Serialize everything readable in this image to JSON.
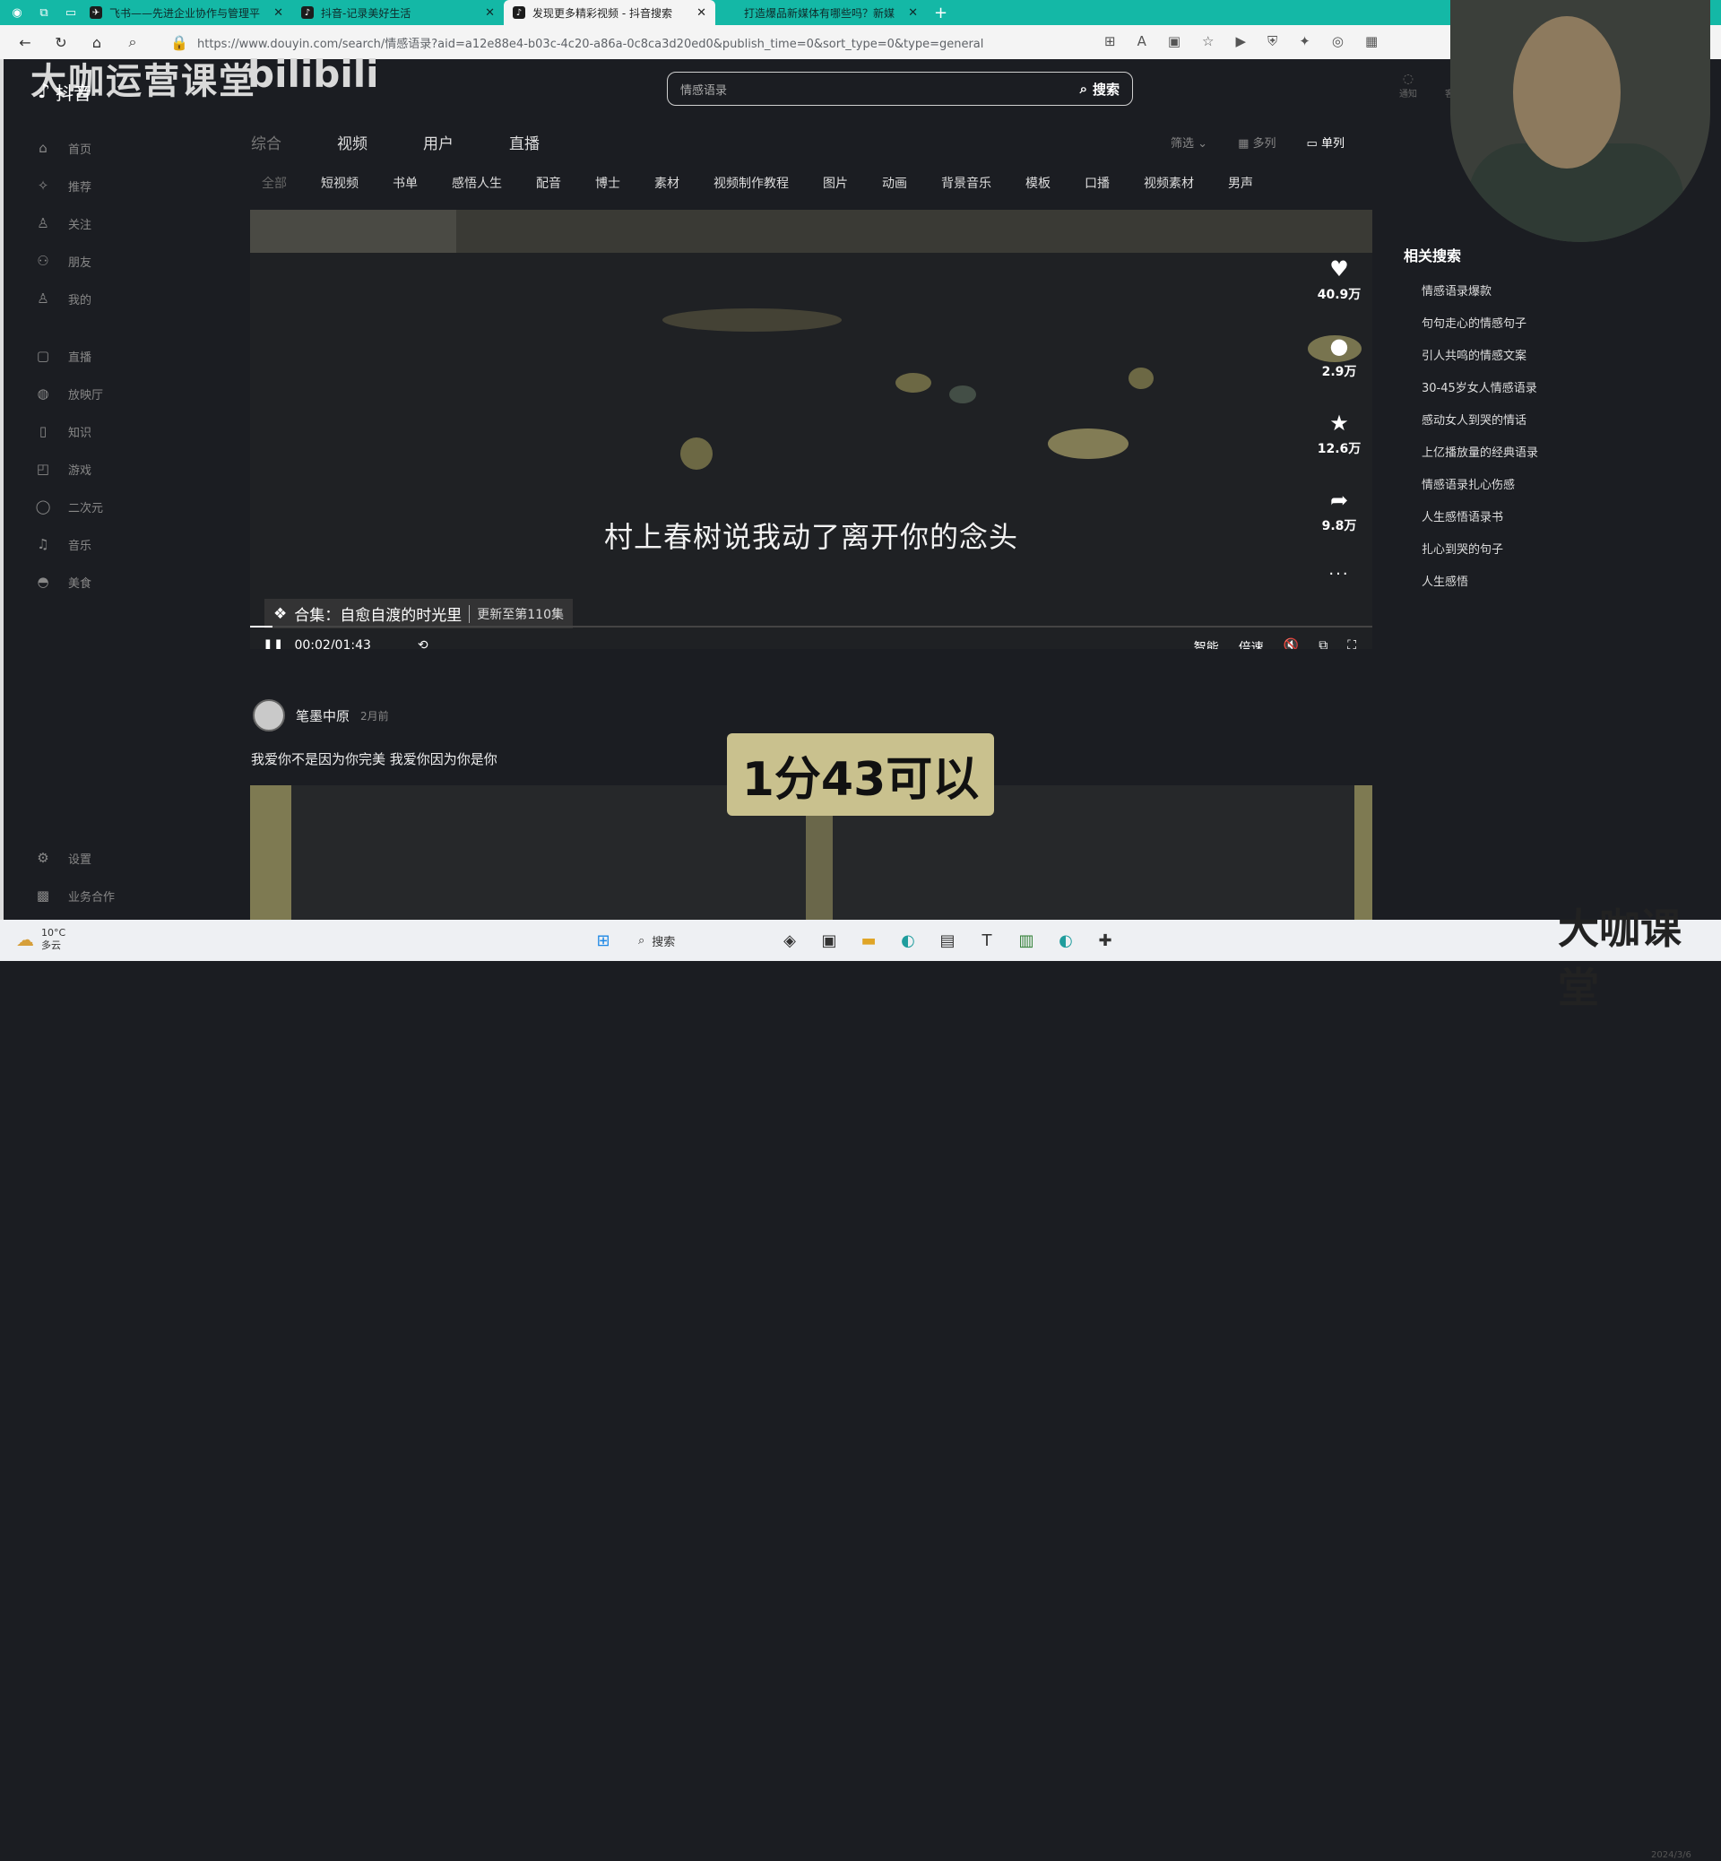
{
  "browser": {
    "tabs": [
      {
        "title": "飞书——先进企业协作与管理平",
        "icon": "feishu-icon"
      },
      {
        "title": "抖音-记录美好生活",
        "icon": "douyin-icon"
      },
      {
        "title": "发现更多精彩视频 - 抖音搜索",
        "icon": "douyin-icon",
        "active": true
      },
      {
        "title": "打造爆品新媒体有哪些吗？新媒",
        "icon": "page-icon"
      }
    ],
    "url": "https://www.douyin.com/search/情感语录?aid=a12e88e4-b03c-4c20-a86a-0c8ca3d20ed0&publish_time=0&sort_type=0&type=general"
  },
  "header": {
    "brand_text": "大咖运营课堂",
    "brand_bili": "bilibili",
    "logo_text": "抖音",
    "search_value": "情感语录",
    "search_button": "搜索",
    "icons": [
      "通知",
      "客户端"
    ]
  },
  "sidebar": {
    "items": [
      {
        "label": "首页",
        "icon": "home-icon"
      },
      {
        "label": "推荐",
        "icon": "recommend-icon"
      },
      {
        "label": "关注",
        "icon": "follow-icon"
      },
      {
        "label": "朋友",
        "icon": "friends-icon"
      },
      {
        "label": "我的",
        "icon": "me-icon"
      }
    ],
    "items2": [
      {
        "label": "直播",
        "icon": "live-icon"
      },
      {
        "label": "放映厅",
        "icon": "cinema-icon"
      },
      {
        "label": "知识",
        "icon": "knowledge-icon"
      },
      {
        "label": "游戏",
        "icon": "game-icon"
      },
      {
        "label": "二次元",
        "icon": "anime-icon"
      },
      {
        "label": "音乐",
        "icon": "music-icon"
      },
      {
        "label": "美食",
        "icon": "food-icon"
      }
    ],
    "bottom": [
      {
        "label": "设置",
        "icon": "settings-icon"
      },
      {
        "label": "业务合作",
        "icon": "business-icon"
      }
    ]
  },
  "main": {
    "tabs": [
      "综合",
      "视频",
      "用户",
      "直播"
    ],
    "view": {
      "filter": "筛选",
      "multi": "多列",
      "single": "单列"
    },
    "subtags": [
      "全部",
      "短视频",
      "书单",
      "感悟人生",
      "配音",
      "博士",
      "素材",
      "视频制作教程",
      "图片",
      "动画",
      "背景音乐",
      "模板",
      "口播",
      "视频素材",
      "男声"
    ]
  },
  "video": {
    "subtitle": "村上春树说我动了离开你的念头",
    "collection": "合集：自愈自渡的时光里",
    "collection_update": "更新至第110集",
    "time": "00:02/01:43",
    "progress": 0.02,
    "controls": [
      "智能",
      "倍速"
    ],
    "stats": {
      "likes": "40.9万",
      "comments": "2.9万",
      "favorites": "12.6万",
      "shares": "9.8万"
    },
    "author": "笔墨中原",
    "posted": "2月前",
    "description": "我爱你不是因为你完美 我爱你因为你是你",
    "caption": "1分43可以"
  },
  "related": {
    "title": "相关搜索",
    "items": [
      "情感语录爆款",
      "句句走心的情感句子",
      "引人共鸣的情感文案",
      "30-45岁女人情感语录",
      "感动女人到哭的情话",
      "上亿播放量的经典语录",
      "情感语录扎心伤感",
      "人生感悟语录书",
      "扎心到哭的句子",
      "人生感悟"
    ]
  },
  "taskbar": {
    "weather_temp": "10°C",
    "weather_desc": "多云",
    "search_label": "搜索",
    "watermark": "大咖课堂",
    "clock_date": "2024/3/6"
  }
}
